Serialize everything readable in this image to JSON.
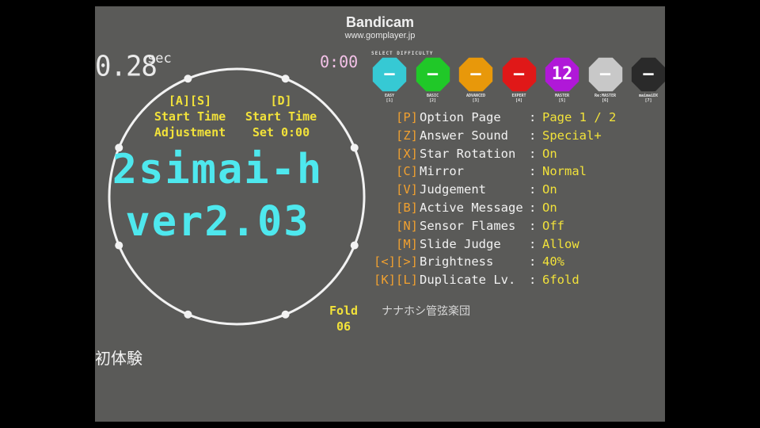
{
  "watermark": {
    "title": "Bandicam",
    "url": "www.gomplayer.jp"
  },
  "timer": {
    "value": "0.28",
    "unit": "sec"
  },
  "clock": "0:00",
  "controls": {
    "left": {
      "keys": "[A][S]",
      "line1": "Start Time",
      "line2": "Adjustment"
    },
    "right": {
      "keys": "[D]",
      "line1": "Start Time",
      "line2": "Set 0:00"
    }
  },
  "song": {
    "title": "2simai-h",
    "version": "ver2.03",
    "artist": "ナナホシ管弦楽団",
    "genre": "初体験"
  },
  "difficulty": {
    "header": "SELECT DIFFICULTY",
    "items": [
      {
        "value": "—",
        "label": "EASY",
        "key": "[1]",
        "color": "#36c9d4"
      },
      {
        "value": "—",
        "label": "BASIC",
        "key": "[2]",
        "color": "#20c828"
      },
      {
        "value": "—",
        "label": "ADVANCED",
        "key": "[3]",
        "color": "#e8980a"
      },
      {
        "value": "—",
        "label": "EXPERT",
        "key": "[4]",
        "color": "#e01818"
      },
      {
        "value": "12",
        "label": "MASTER",
        "key": "[5]",
        "color": "#b018d8"
      },
      {
        "value": "—",
        "label": "Re:MASTER",
        "key": "[6]",
        "color": "#c8c8c8"
      },
      {
        "value": "—",
        "label": "maimaiDX",
        "key": "[7]",
        "color": "#2a2a2a"
      }
    ]
  },
  "options": [
    {
      "key": "[P]",
      "label": "Option Page",
      "value": "Page 1 / 2"
    },
    {
      "key": "[Z]",
      "label": "Answer Sound",
      "value": "Special+"
    },
    {
      "key": "[X]",
      "label": "Star Rotation",
      "value": "On"
    },
    {
      "key": "[C]",
      "label": "Mirror",
      "value": "Normal"
    },
    {
      "key": "[V]",
      "label": "Judgement",
      "value": "On"
    },
    {
      "key": "[B]",
      "label": "Active Message",
      "value": "On"
    },
    {
      "key": "[N]",
      "label": "Sensor Flames",
      "value": "Off"
    },
    {
      "key": "[M]",
      "label": "Slide Judge",
      "value": "Allow"
    },
    {
      "key": "[<][>]",
      "label": "Brightness",
      "value": "40%"
    },
    {
      "key": "[K][L]",
      "label": "Duplicate Lv.",
      "value": "6fold"
    }
  ],
  "fold": {
    "label": "Fold",
    "value": "06"
  }
}
